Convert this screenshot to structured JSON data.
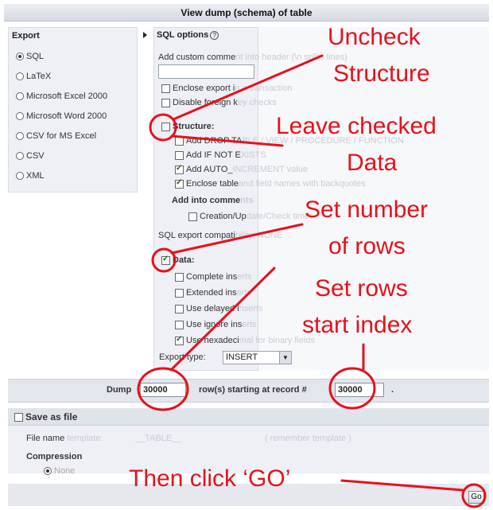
{
  "title": "View dump (schema) of table",
  "export": {
    "heading": "Export",
    "formats": [
      {
        "label": "SQL",
        "selected": true
      },
      {
        "label": "LaTeX",
        "selected": false
      },
      {
        "label": "Microsoft Excel 2000",
        "selected": false
      },
      {
        "label": "Microsoft Word 2000",
        "selected": false
      },
      {
        "label": "CSV for MS Excel",
        "selected": false
      },
      {
        "label": "CSV",
        "selected": false
      },
      {
        "label": "XML",
        "selected": false
      }
    ]
  },
  "sql_options": {
    "heading": "SQL options",
    "help_icon": "help-icon",
    "custom_comment_label": "Add custom comme",
    "custom_comment_ghost": "nt into header (\\n splits lines)",
    "custom_comment_value": "",
    "enclose_export": {
      "label": "Enclose export i",
      "ghost": "n a transaction",
      "checked": false
    },
    "disable_fk": {
      "label": "Disable foreign k",
      "ghost": "ey checks",
      "checked": false
    },
    "structure": {
      "label": "Structure:",
      "checked": false
    },
    "structure_options": [
      {
        "label": "Add DROP TA",
        "ghost": "BLE / VIEW / PROCEDURE / FUNCTION",
        "checked": false
      },
      {
        "label": "Add IF NOT E",
        "ghost": "XISTS",
        "checked": false
      },
      {
        "label": "Add AUTO_",
        "ghost": "INCREMENT value",
        "checked": true
      },
      {
        "label": "Enclose table",
        "ghost": " and field names with backquotes",
        "checked": true
      }
    ],
    "add_into_comments": "Add into comme",
    "add_into_comments_ghost": "nts",
    "creation_update": {
      "label": "Creation/Up",
      "ghost": "date/Check times",
      "checked": false
    },
    "compat_label": "SQL export compati",
    "compat_ghost": "bility:  NONE",
    "data": {
      "label": "Data:",
      "checked": true
    },
    "data_options": [
      {
        "label": "Complete ins",
        "ghost": "erts",
        "checked": false
      },
      {
        "label": "Extended ins",
        "ghost": "erts",
        "checked": false
      },
      {
        "label": "Use delayed i",
        "ghost": "nserts",
        "checked": false
      },
      {
        "label": "Use ignore ins",
        "ghost": "erts",
        "checked": false
      },
      {
        "label": "Use hexadeci",
        "ghost": "mal for binary fields",
        "checked": true
      }
    ],
    "export_type_label": "Export type:",
    "export_type_value": "INSERT"
  },
  "dump": {
    "prefix": "Dump",
    "rows_value": "30000",
    "middle": "row(s) starting at record #",
    "start_value": "30000",
    "suffix": "."
  },
  "save_file": {
    "label": "Save as file",
    "checked": false,
    "file_name_label": "File name",
    "file_name_ghost": "template:",
    "file_name_value": "__TABLE__",
    "remember_ghost": "( remember template )",
    "compression_label": "Compression",
    "compression_option": "None"
  },
  "go_label": "Go",
  "annotations": {
    "uncheck_structure": [
      "Uncheck",
      "Structure"
    ],
    "leave_data": [
      "Leave checked",
      "Data"
    ],
    "set_rows": [
      "Set number",
      "of rows"
    ],
    "set_start": [
      "Set rows",
      "start index"
    ],
    "click_go": "Then click ‘GO’"
  },
  "colors": {
    "annotation": "#e8101a",
    "panel": "#eef0f5"
  }
}
